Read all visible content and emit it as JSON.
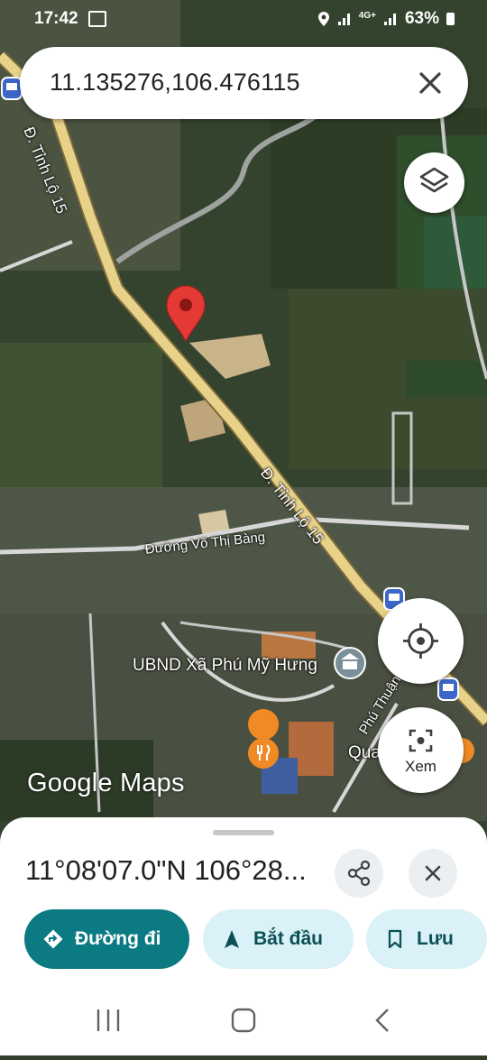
{
  "status_bar": {
    "time": "17:42",
    "network": "4G+",
    "battery": "63%"
  },
  "search": {
    "query": "11.135276,106.476115"
  },
  "map": {
    "road_labels": [
      "Đ. Tỉnh Lộ 15",
      "Đ. Tỉnh Lộ 15",
      "Đường Võ Thị Bàng",
      "Phú Thuận"
    ],
    "places": [
      "UBND Xã Phú Mỹ Hưng",
      "Qua"
    ],
    "logo": "Google Maps"
  },
  "controls": {
    "xem_label": "Xem"
  },
  "sheet": {
    "coordinates": "11°08'07.0\"N 106°28...",
    "directions_label": "Đường đi",
    "start_label": "Bắt đầu",
    "save_label": "Lưu"
  },
  "colors": {
    "accent": "#0b7a82",
    "pin": "#e53935",
    "road": "#e8d28a",
    "light_button": "#d9f1f7"
  }
}
